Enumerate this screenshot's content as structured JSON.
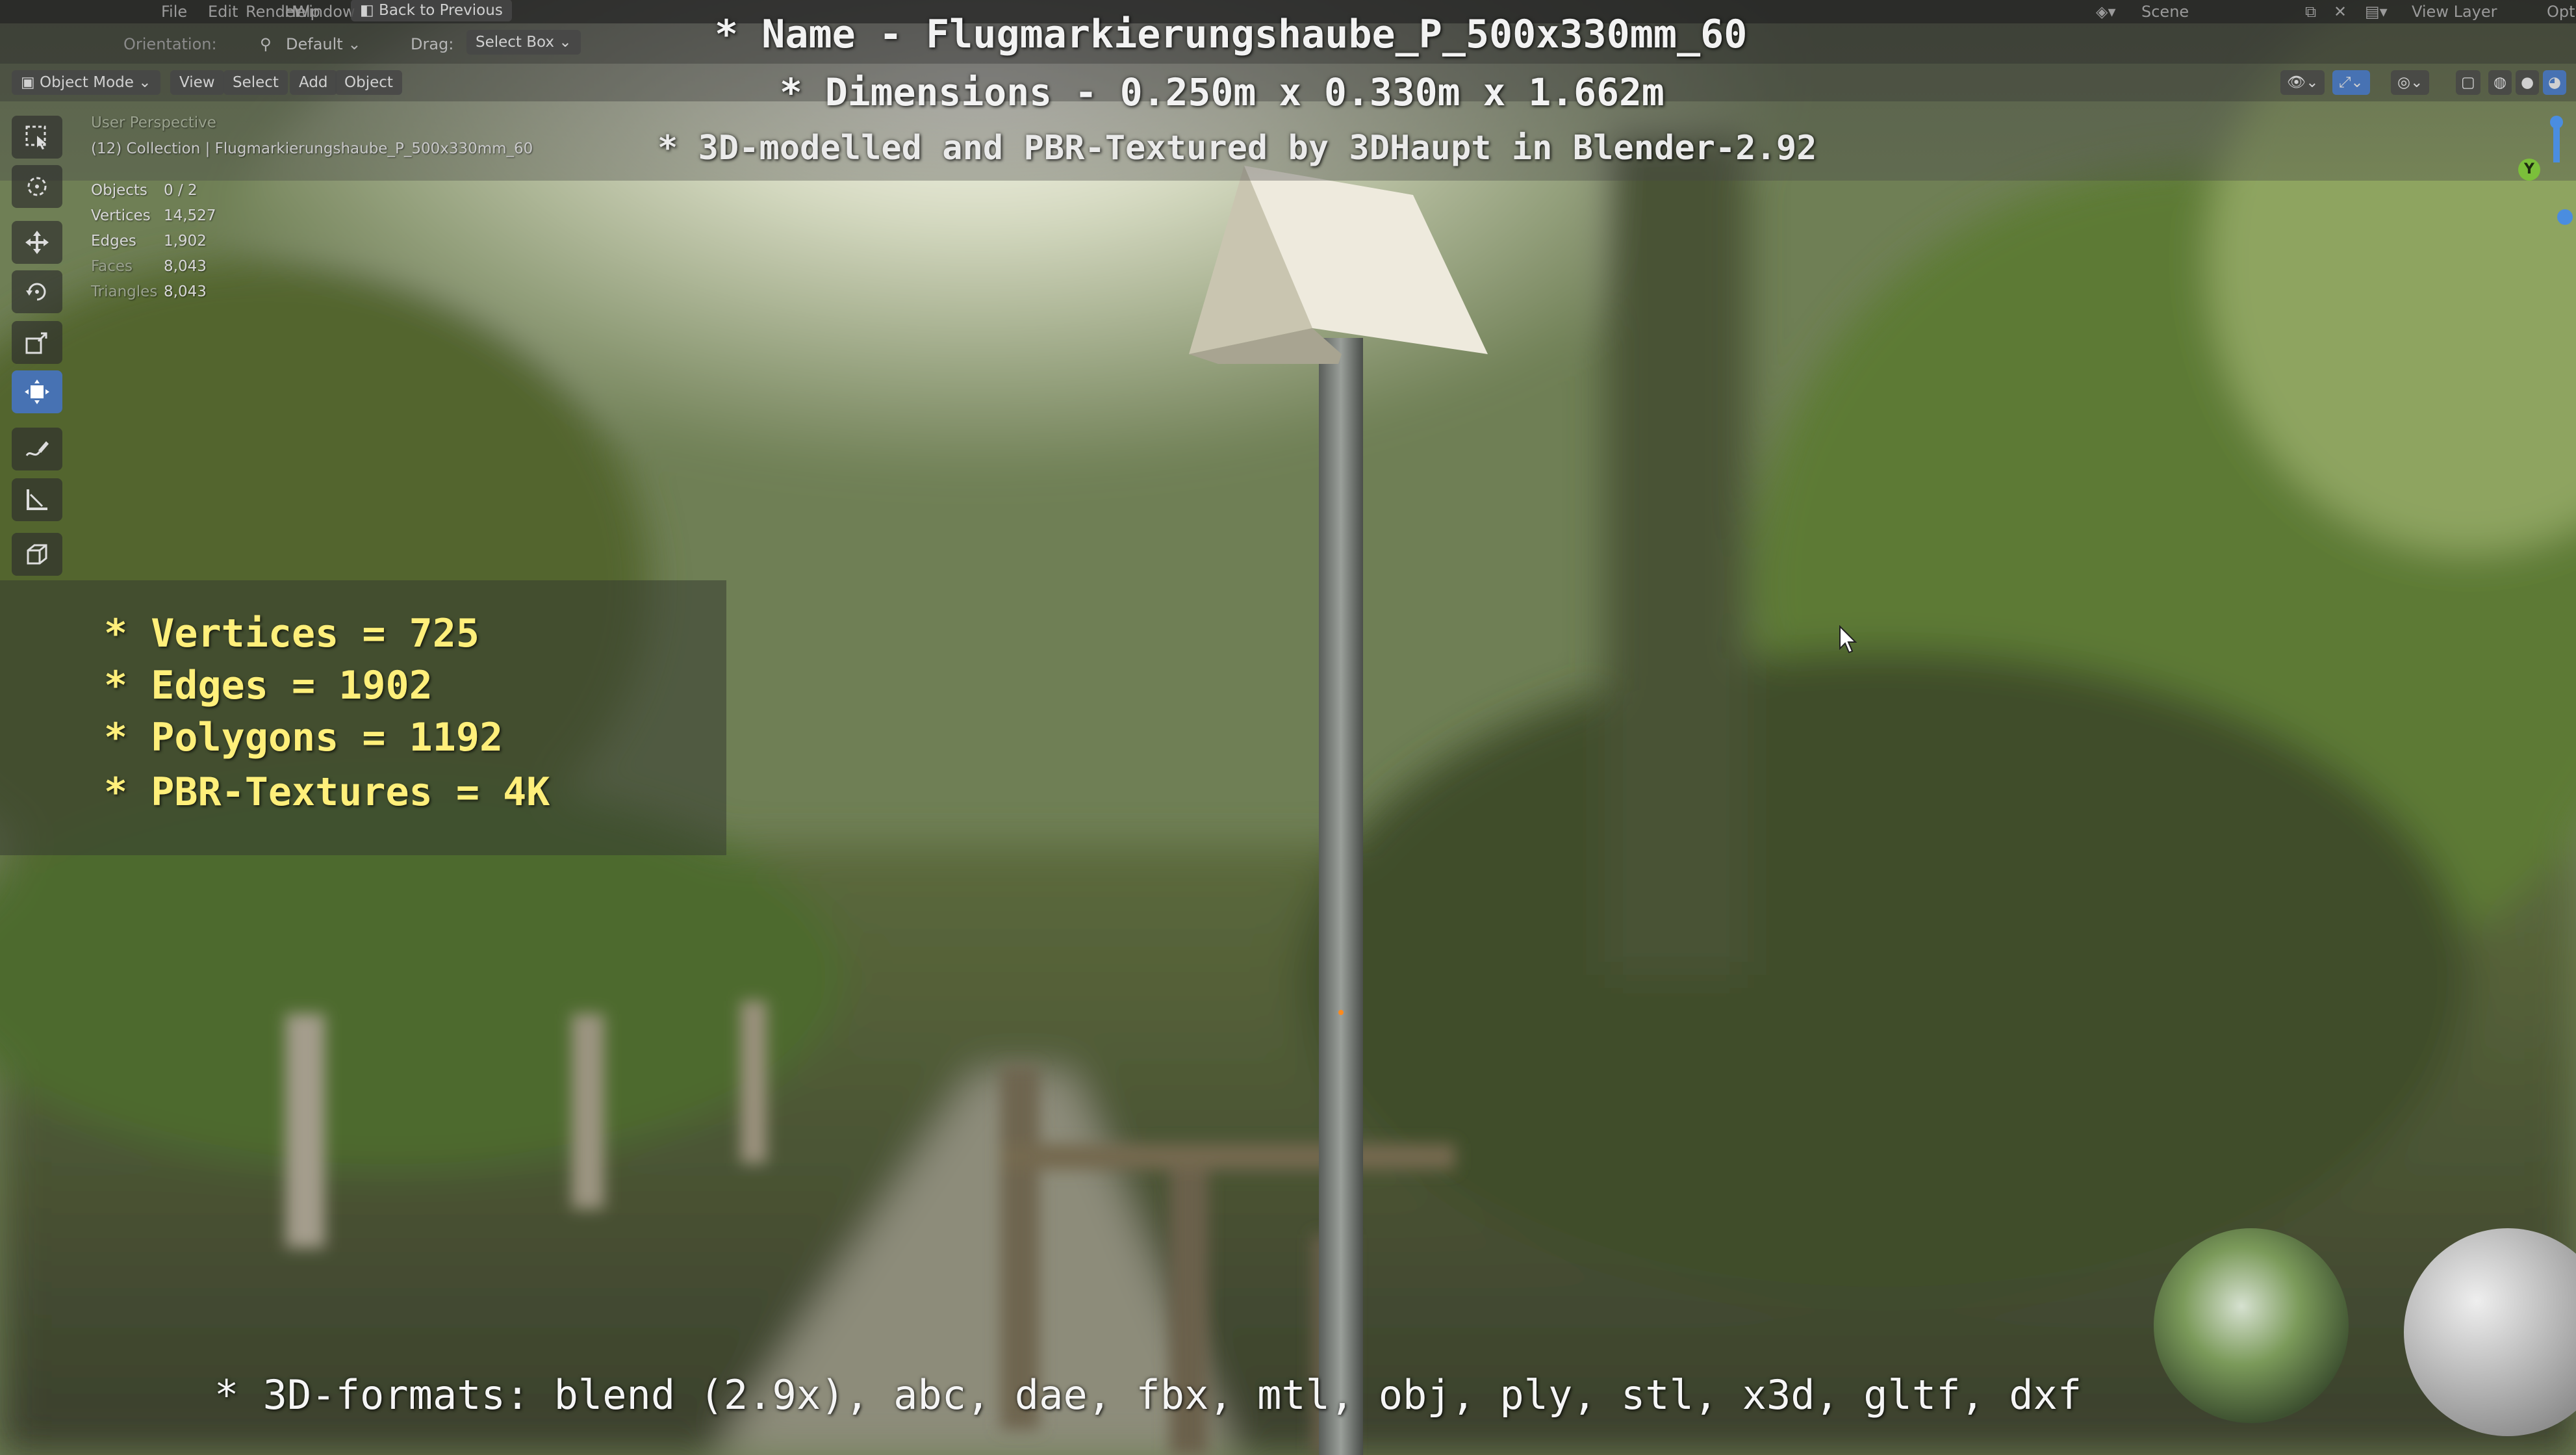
{
  "top_menu": {
    "items": [
      "File",
      "Edit",
      "Render",
      "Window",
      "Help"
    ],
    "back_button": "Back to Previous",
    "scene_label": "Scene",
    "view_layer_label": "View Layer",
    "options_label": "Opti"
  },
  "header": {
    "orientation_label": "Orientation:",
    "transform_pivot": "Default",
    "drag_label": "Drag:",
    "drag_value": "Select Box"
  },
  "viewport_header": {
    "mode": "Object Mode",
    "menus": [
      "View",
      "Select",
      "Add",
      "Object"
    ]
  },
  "viewport_info": {
    "perspective": "User Perspective",
    "collection": "(12) Collection | Flugmarkierungshaube_P_500x330mm_60",
    "objects_label": "Objects",
    "objects_value": "0 / 2",
    "vertices_label": "Vertices",
    "vertices_value": "14,527",
    "edges_label": "Edges",
    "edges_value": "1,902",
    "faces_label": "Faces",
    "faces_value": "8,043",
    "triangles_label": "Triangles",
    "triangles_value": "8,043"
  },
  "overlay": {
    "name_line": "* Name - Flugmarkierungshaube_P_500x330mm_60",
    "dimensions_line": "* Dimensions -  0.250m x 0.330m x 1.662m",
    "credit_line": "* 3D-modelled and PBR-Textured by 3DHaupt in Blender-2.92",
    "stats": [
      "* Vertices = 725",
      "* Edges = 1902",
      "* Polygons = 1192",
      "* PBR-Textures = 4K"
    ],
    "formats_line": "* 3D-formats: blend (2.9x), abc, dae, fbx, mtl, obj, ply, stl, x3d, gltf, dxf"
  },
  "tools": [
    "select-box-icon",
    "cursor-icon",
    "move-icon",
    "rotate-icon",
    "scale-icon",
    "transform-icon",
    "annotate-icon",
    "measure-icon",
    "add-cube-icon"
  ],
  "gizmo": {
    "axis_y_label": "Y"
  },
  "colors": {
    "active_tool": "#4772b3",
    "stats_text": "#ffef7a",
    "overlay_text": "#f2f2f2"
  }
}
